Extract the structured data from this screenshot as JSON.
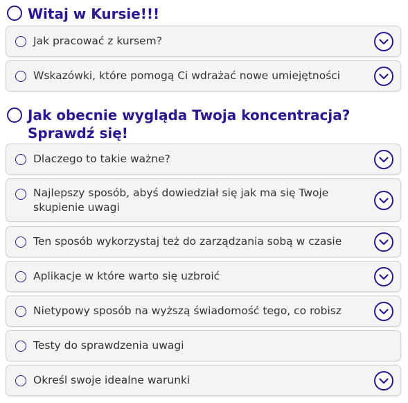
{
  "colors": {
    "accent": "#2e1591",
    "item_bg": "#f4f4f4",
    "item_border": "#cfcfcf",
    "text": "#333333"
  },
  "sections": [
    {
      "title": "Witaj w Kursie!!!",
      "items": [
        {
          "label": "Jak pracować z kursem?",
          "expand_icon": "chevron-down-icon"
        },
        {
          "label": "Wskazówki, które pomogą Ci wdrażać nowe umiejętności",
          "expand_icon": "chevron-down-icon"
        }
      ]
    },
    {
      "title_line1": "Jak obecnie wygląda Twoja koncentracja?",
      "title_line2": "Sprawdź się!",
      "items": [
        {
          "label": "Dlaczego to takie ważne?",
          "expand_icon": "chevron-down-icon"
        },
        {
          "label_line1": "Najlepszy sposób, abyś dowiedział się jak ma się Twoje",
          "label_line2": "skupienie uwagi",
          "expand_icon": "chevron-down-icon"
        },
        {
          "label": "Ten sposób wykorzystaj też do zarządzania sobą w czasie",
          "expand_icon": "chevron-down-icon"
        },
        {
          "label": "Aplikacje w które warto się uzbroić",
          "expand_icon": "chevron-down-icon"
        },
        {
          "label": "Nietypowy sposób na wyższą świadomość tego, co robisz",
          "expand_icon": "chevron-down-icon"
        },
        {
          "label": "Testy do sprawdzenia uwagi"
        },
        {
          "label": "Określ swoje idealne warunki",
          "expand_icon": "chevron-down-icon"
        }
      ]
    }
  ]
}
